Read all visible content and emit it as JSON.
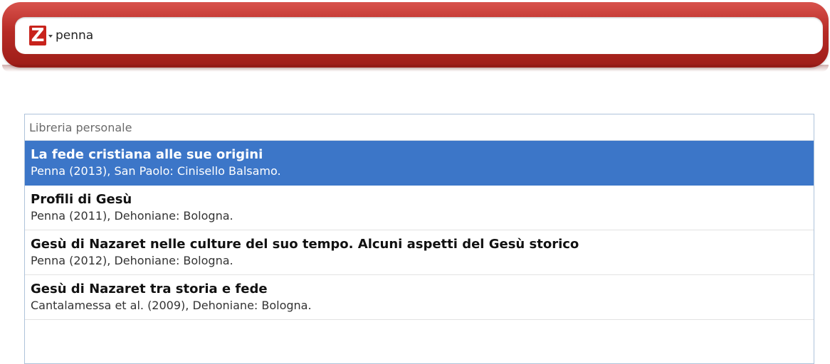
{
  "search": {
    "engine_logo": "Z",
    "engine_icon": "zotero-z-icon",
    "query": "penna"
  },
  "results": {
    "section_label": "Libreria personale",
    "items": [
      {
        "title": "La fede cristiana alle sue origini",
        "meta": "Penna (2013), San Paolo: Cinisello Balsamo.",
        "selected": true
      },
      {
        "title": "Profili di Gesù",
        "meta": "Penna (2011), Dehoniane: Bologna.",
        "selected": false
      },
      {
        "title": "Gesù di Nazaret nelle culture del suo tempo. Alcuni aspetti del Gesù storico",
        "meta": "Penna (2012), Dehoniane: Bologna.",
        "selected": false
      },
      {
        "title": "Gesù di Nazaret tra storia e fede",
        "meta": "Cantalamessa et al. (2009), Dehoniane: Bologna.",
        "selected": false
      }
    ]
  },
  "colors": {
    "bar_red": "#b72b25",
    "selection_blue": "#3c76c8",
    "panel_border": "#aec3da"
  }
}
